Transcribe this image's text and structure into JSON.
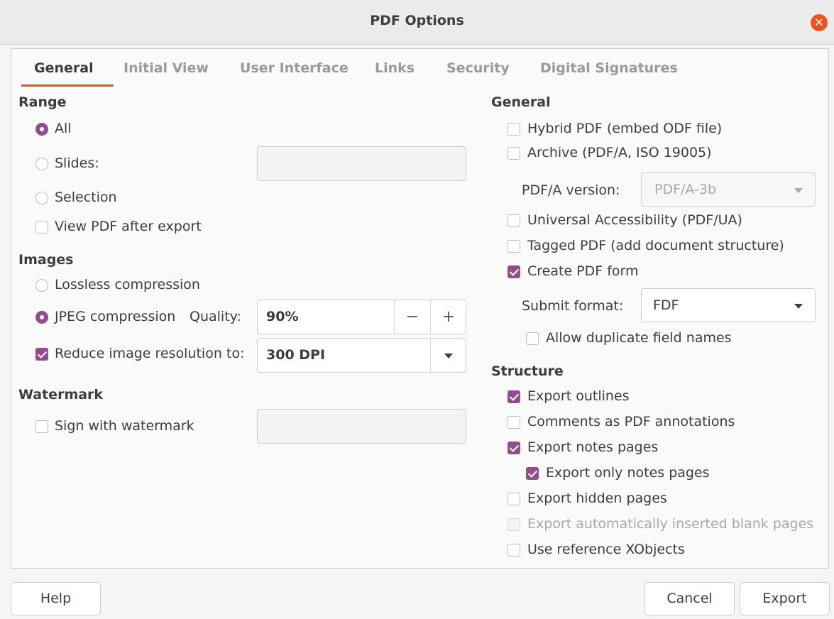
{
  "window": {
    "title": "PDF Options"
  },
  "tabs": [
    {
      "label": "General",
      "active": true
    },
    {
      "label": "Initial View"
    },
    {
      "label": "User Interface"
    },
    {
      "label": "Links"
    },
    {
      "label": "Security"
    },
    {
      "label": "Digital Signatures"
    }
  ],
  "range": {
    "heading": "Range",
    "all_label": "All",
    "slides_label": "Slides:",
    "slides_value": "",
    "selection_label": "Selection",
    "view_after_label": "View PDF after export",
    "selected": "All",
    "view_after_checked": false
  },
  "images": {
    "heading": "Images",
    "lossless_label": "Lossless compression",
    "jpeg_label": "JPEG compression",
    "quality_label": "Quality:",
    "quality_value": "90%",
    "minus_label": "−",
    "plus_label": "+",
    "reduce_label": "Reduce image resolution to:",
    "reduce_checked": true,
    "dpi_value": "300 DPI",
    "selected": "JPEG compression"
  },
  "watermark": {
    "heading": "Watermark",
    "sign_label": "Sign with watermark",
    "sign_checked": false,
    "value": ""
  },
  "general": {
    "heading": "General",
    "hybrid_label": "Hybrid PDF (embed ODF file)",
    "archive_label": "Archive (PDF/A, ISO 19005)",
    "pdfa_version_label": "PDF/A version:",
    "pdfa_version_value": "PDF/A-3b",
    "ua_label": "Universal Accessibility (PDF/UA)",
    "tagged_label": "Tagged PDF (add document structure)",
    "form_label": "Create PDF form",
    "form_checked": true,
    "submit_label": "Submit format:",
    "submit_value": "FDF",
    "duplicate_label": "Allow duplicate field names"
  },
  "structure": {
    "heading": "Structure",
    "outlines_label": "Export outlines",
    "comments_label": "Comments as PDF annotations",
    "notes_label": "Export notes pages",
    "only_notes_label": "Export only notes pages",
    "hidden_label": "Export hidden pages",
    "blank_label": "Export automatically inserted blank pages",
    "xobjects_label": "Use reference XObjects"
  },
  "buttons": {
    "help": "Help",
    "cancel": "Cancel",
    "export": "Export"
  },
  "colors": {
    "accent": "#e95420",
    "check": "#924d8b"
  }
}
